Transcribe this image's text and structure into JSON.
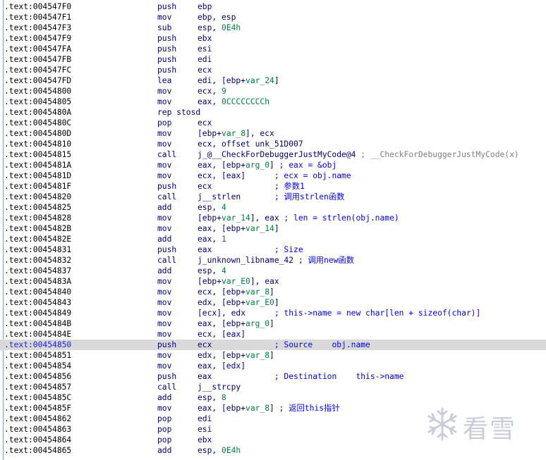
{
  "watermark": {
    "text": "看雪",
    "icon": "snowflake-icon",
    "color": "#c8cdd8"
  },
  "colors": {
    "address": "#000000",
    "mnemonic": "#000080",
    "number": "#008040",
    "comment": "#0000ff",
    "highlight": "#d9d9d9"
  },
  "highlighted_index": 32,
  "lines": [
    {
      "addr": ".text:004547F0",
      "mn": "push",
      "ops": [
        [
          "ebp",
          ""
        ]
      ]
    },
    {
      "addr": ".text:004547F1",
      "mn": "mov",
      "ops": [
        [
          "ebp, esp",
          ""
        ]
      ]
    },
    {
      "addr": ".text:004547F3",
      "mn": "sub",
      "ops": [
        [
          "esp, ",
          ""
        ],
        [
          "0E4h",
          "num"
        ]
      ]
    },
    {
      "addr": ".text:004547F9",
      "mn": "push",
      "ops": [
        [
          "ebx",
          ""
        ]
      ]
    },
    {
      "addr": ".text:004547FA",
      "mn": "push",
      "ops": [
        [
          "esi",
          ""
        ]
      ]
    },
    {
      "addr": ".text:004547FB",
      "mn": "push",
      "ops": [
        [
          "edi",
          ""
        ]
      ]
    },
    {
      "addr": ".text:004547FC",
      "mn": "push",
      "ops": [
        [
          "ecx",
          ""
        ]
      ]
    },
    {
      "addr": ".text:004547FD",
      "mn": "lea",
      "ops": [
        [
          "edi, [ebp+",
          ""
        ],
        [
          "var_24",
          "var"
        ],
        [
          "]",
          ""
        ]
      ]
    },
    {
      "addr": ".text:00454800",
      "mn": "mov",
      "ops": [
        [
          "ecx, ",
          ""
        ],
        [
          "9",
          "num"
        ]
      ]
    },
    {
      "addr": ".text:00454805",
      "mn": "mov",
      "ops": [
        [
          "eax, ",
          ""
        ],
        [
          "0CCCCCCCCh",
          "num"
        ]
      ]
    },
    {
      "addr": ".text:0045480A",
      "mn": "rep stosd",
      "ops": []
    },
    {
      "addr": ".text:0045480C",
      "mn": "pop",
      "ops": [
        [
          "ecx",
          ""
        ]
      ]
    },
    {
      "addr": ".text:0045480D",
      "mn": "mov",
      "ops": [
        [
          "[ebp+",
          ""
        ],
        [
          "var_8",
          "var"
        ],
        [
          "], ecx",
          ""
        ]
      ]
    },
    {
      "addr": ".text:00454810",
      "mn": "mov",
      "ops": [
        [
          "ecx, offset unk_51D007",
          ""
        ]
      ]
    },
    {
      "addr": ".text:00454815",
      "mn": "call",
      "ops": [
        [
          "j_@__CheckForDebuggerJustMyCode@4",
          ""
        ],
        [
          " ; __CheckForDebuggerJustMyCode(x)",
          "gray"
        ]
      ]
    },
    {
      "addr": ".text:0045481A",
      "mn": "mov",
      "ops": [
        [
          "eax, [ebp+",
          ""
        ],
        [
          "arg_0",
          "var"
        ],
        [
          "]",
          ""
        ],
        [
          " ; eax = &obj",
          "cmt"
        ]
      ]
    },
    {
      "addr": ".text:0045481D",
      "mn": "mov",
      "ops": [
        [
          "ecx, [eax]",
          ""
        ],
        [
          "      ; ecx = obj.name",
          "cmt"
        ]
      ]
    },
    {
      "addr": ".text:0045481F",
      "mn": "push",
      "ops": [
        [
          "ecx",
          ""
        ],
        [
          "             ; 参数1",
          "cmt"
        ]
      ]
    },
    {
      "addr": ".text:00454820",
      "mn": "call",
      "ops": [
        [
          "j__strlen",
          ""
        ],
        [
          "       ; 调用strlen函数",
          "cmt"
        ]
      ]
    },
    {
      "addr": ".text:00454825",
      "mn": "add",
      "ops": [
        [
          "esp, ",
          ""
        ],
        [
          "4",
          "num"
        ]
      ]
    },
    {
      "addr": ".text:00454828",
      "mn": "mov",
      "ops": [
        [
          "[ebp+",
          ""
        ],
        [
          "var_14",
          "var"
        ],
        [
          "], eax",
          ""
        ],
        [
          " ; len = strlen(obj.name)",
          "cmt"
        ]
      ]
    },
    {
      "addr": ".text:0045482B",
      "mn": "mov",
      "ops": [
        [
          "eax, [ebp+",
          ""
        ],
        [
          "var_14",
          "var"
        ],
        [
          "]",
          ""
        ]
      ]
    },
    {
      "addr": ".text:0045482E",
      "mn": "add",
      "ops": [
        [
          "eax, ",
          ""
        ],
        [
          "1",
          "num"
        ]
      ]
    },
    {
      "addr": ".text:00454831",
      "mn": "push",
      "ops": [
        [
          "eax",
          ""
        ],
        [
          "             ; Size",
          "cmt"
        ]
      ]
    },
    {
      "addr": ".text:00454832",
      "mn": "call",
      "ops": [
        [
          "j_unknown_libname_42",
          ""
        ],
        [
          " ; 调用new函数",
          "cmt"
        ]
      ]
    },
    {
      "addr": ".text:00454837",
      "mn": "add",
      "ops": [
        [
          "esp, ",
          ""
        ],
        [
          "4",
          "num"
        ]
      ]
    },
    {
      "addr": ".text:0045483A",
      "mn": "mov",
      "ops": [
        [
          "[ebp+",
          ""
        ],
        [
          "var_E0",
          "var"
        ],
        [
          "], eax",
          ""
        ]
      ]
    },
    {
      "addr": ".text:00454840",
      "mn": "mov",
      "ops": [
        [
          "ecx, [ebp+",
          ""
        ],
        [
          "var_8",
          "var"
        ],
        [
          "]",
          ""
        ]
      ]
    },
    {
      "addr": ".text:00454843",
      "mn": "mov",
      "ops": [
        [
          "edx, [ebp+",
          ""
        ],
        [
          "var_E0",
          "var"
        ],
        [
          "]",
          ""
        ]
      ]
    },
    {
      "addr": ".text:00454849",
      "mn": "mov",
      "ops": [
        [
          "[ecx], edx",
          ""
        ],
        [
          "      ; this->name = new char[len + sizeof(char)]",
          "cmt"
        ]
      ]
    },
    {
      "addr": ".text:0045484B",
      "mn": "mov",
      "ops": [
        [
          "eax, [ebp+",
          ""
        ],
        [
          "arg_0",
          "var"
        ],
        [
          "]",
          ""
        ]
      ]
    },
    {
      "addr": ".text:0045484E",
      "mn": "mov",
      "ops": [
        [
          "ecx, [eax]",
          ""
        ]
      ]
    },
    {
      "addr": ".text:00454850",
      "mn": "push",
      "ops": [
        [
          "ecx",
          ""
        ],
        [
          "             ; Source    obj.name",
          "cmt"
        ]
      ]
    },
    {
      "addr": ".text:00454851",
      "mn": "mov",
      "ops": [
        [
          "edx, [ebp+",
          ""
        ],
        [
          "var_8",
          "var"
        ],
        [
          "]",
          ""
        ]
      ]
    },
    {
      "addr": ".text:00454854",
      "mn": "mov",
      "ops": [
        [
          "eax, [edx]",
          ""
        ]
      ]
    },
    {
      "addr": ".text:00454856",
      "mn": "push",
      "ops": [
        [
          "eax",
          ""
        ],
        [
          "             ; Destination    this->name",
          "cmt"
        ]
      ]
    },
    {
      "addr": ".text:00454857",
      "mn": "call",
      "ops": [
        [
          "j__strcpy",
          ""
        ]
      ]
    },
    {
      "addr": ".text:0045485C",
      "mn": "add",
      "ops": [
        [
          "esp, ",
          ""
        ],
        [
          "8",
          "num"
        ]
      ]
    },
    {
      "addr": ".text:0045485F",
      "mn": "mov",
      "ops": [
        [
          "eax, [ebp+",
          ""
        ],
        [
          "var_8",
          "var"
        ],
        [
          "]",
          ""
        ],
        [
          " ; 返回this指针",
          "cmt"
        ]
      ]
    },
    {
      "addr": ".text:00454862",
      "mn": "pop",
      "ops": [
        [
          "edi",
          ""
        ]
      ]
    },
    {
      "addr": ".text:00454863",
      "mn": "pop",
      "ops": [
        [
          "esi",
          ""
        ]
      ]
    },
    {
      "addr": ".text:00454864",
      "mn": "pop",
      "ops": [
        [
          "ebx",
          ""
        ]
      ]
    },
    {
      "addr": ".text:00454865",
      "mn": "add",
      "ops": [
        [
          "esp, ",
          ""
        ],
        [
          "0E4h",
          "num"
        ]
      ]
    }
  ]
}
